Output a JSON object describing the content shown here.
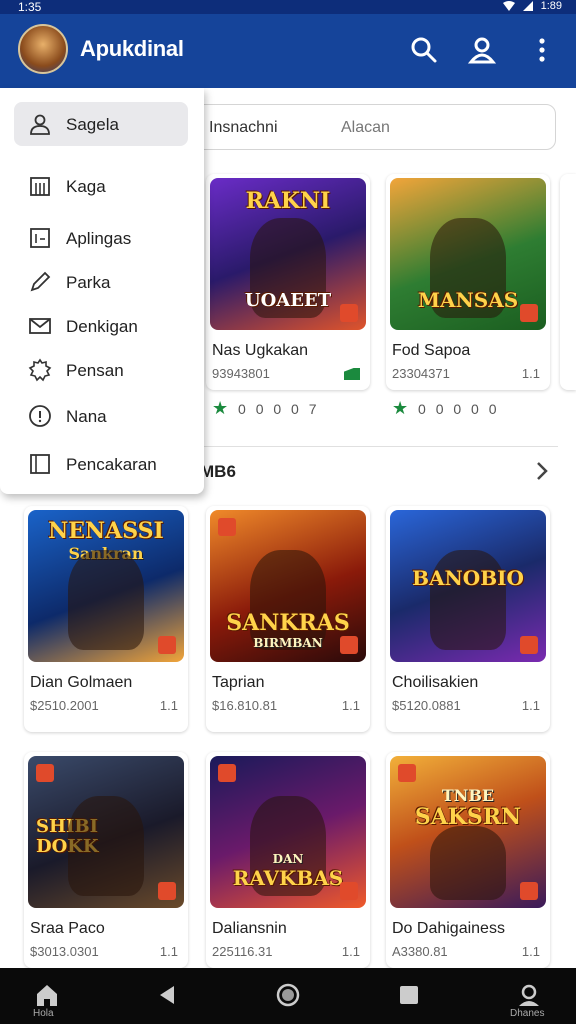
{
  "status": {
    "time": "1:35",
    "battery": "1:89"
  },
  "app": {
    "title": "Apukdinal"
  },
  "search": {
    "left_text": "Insnachni",
    "right_text": "Alacan"
  },
  "drawer": {
    "items": [
      {
        "label": "Sagela",
        "icon": "person-icon",
        "active": true
      },
      {
        "label": "Kaga",
        "icon": "store-icon"
      },
      {
        "label": "Aplingas",
        "icon": "apps-icon"
      },
      {
        "label": "Parka",
        "icon": "pen-icon"
      },
      {
        "label": "Denkigan",
        "icon": "mail-icon"
      },
      {
        "label": "Pensan",
        "icon": "gear-icon"
      },
      {
        "label": "Nana",
        "icon": "info-icon"
      },
      {
        "label": "Pencakaran",
        "icon": "book-icon"
      }
    ]
  },
  "row1": [
    {
      "art_title": "RAKNI",
      "art_sub": "UOAEET",
      "name": "Nas Ugkakan",
      "meta": "93943801"
    },
    {
      "art_title": "MANSAS",
      "art_sub": "",
      "name": "Fod Sapoa",
      "meta": "23304371",
      "rating": "1.1"
    }
  ],
  "row1_stars": [
    {
      "text": "0 0 0 0 7"
    },
    {
      "text": "0 0 0 0 0"
    }
  ],
  "section": {
    "title": "MB6"
  },
  "row2": [
    {
      "art_title": "NENASSI",
      "art_sub": "Sankran",
      "name": "Dian Golmaen",
      "meta": "$2510.2001",
      "rating": "1.1"
    },
    {
      "art_title": "SANKRAS",
      "art_sub": "BIRMBAN",
      "name": "Taprian",
      "meta": "$16.810.81",
      "rating": "1.1"
    },
    {
      "art_title": "BANOBIO",
      "art_sub": "",
      "name": "Choilisakien",
      "meta": "$5120.0881",
      "rating": "1.1"
    }
  ],
  "row3": [
    {
      "art_title": "SHIBI",
      "art_sub": "DOKK",
      "name": "Sraa Paco",
      "meta": "$3013.0301",
      "rating": "1.1"
    },
    {
      "art_title": "RAVKBAS",
      "art_sub": "DAN",
      "name": "Daliansnin",
      "meta": "225116.31",
      "rating": "1.1"
    },
    {
      "art_title": "SAKSRN",
      "art_sub": "TNBE",
      "name": "Do Dahigainess",
      "meta": "A3380.81",
      "rating": "1.1"
    }
  ],
  "nav": {
    "home_label": "Hola",
    "right_label": "Dhanes"
  },
  "colors": {
    "app_bar": "#15449a",
    "accent_green": "#1b8a3e"
  }
}
